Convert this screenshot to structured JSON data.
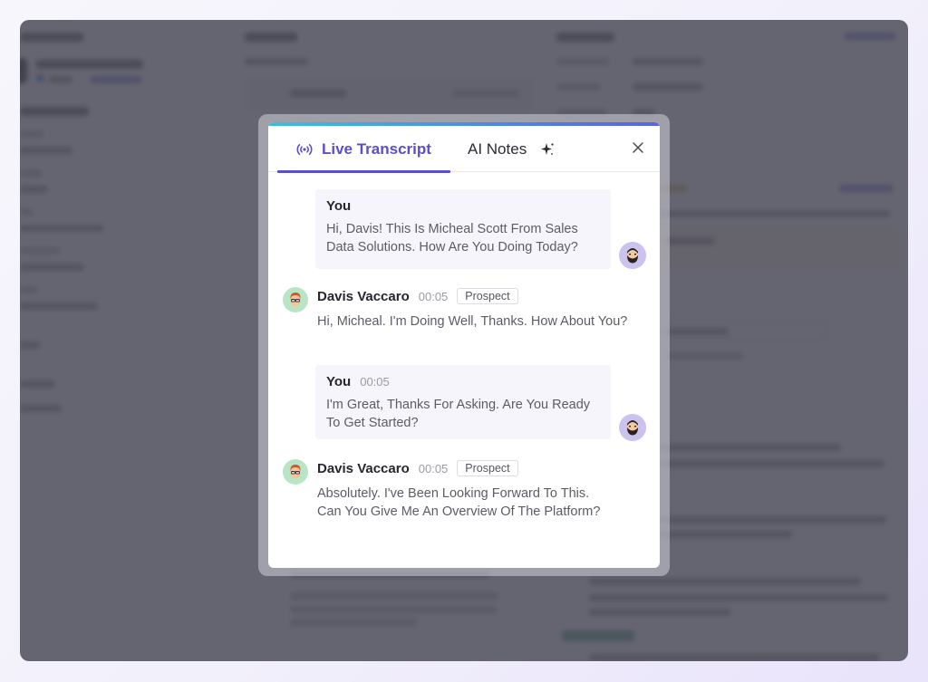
{
  "modal": {
    "tabs": [
      {
        "label": "Live Transcript",
        "icon": "broadcast-icon",
        "active": true
      },
      {
        "label": "AI Notes",
        "icon": "sparkle-icon",
        "active": false
      }
    ],
    "close_icon": "close-icon"
  },
  "colors": {
    "accent": "#5a4fc8",
    "top_gradient_start": "#3cc0dc",
    "top_gradient_end": "#5a63e0",
    "you_bubble_bg": "#f6f5fb",
    "you_avatar_bg": "#cbc3ee",
    "prospect_avatar_bg": "#b8e6c4"
  },
  "transcript": [
    {
      "speaker": "You",
      "time": "",
      "role": "",
      "text": "Hi, Davis! This Is Micheal Scott From Sales Data Solutions. How Are You Doing Today?"
    },
    {
      "speaker": "Davis Vaccaro",
      "time": "00:05",
      "role": "Prospect",
      "text": "Hi, Micheal. I'm Doing Well, Thanks. How About You?"
    },
    {
      "speaker": "You",
      "time": "00:05",
      "role": "",
      "text": "I'm Great, Thanks For Asking. Are You Ready To Get Started?"
    },
    {
      "speaker": "Davis Vaccaro",
      "time": "00:05",
      "role": "Prospect",
      "text": "Absolutely. I've Been Looking Forward To This. Can You Give Me An Overview Of The Platform?"
    }
  ]
}
